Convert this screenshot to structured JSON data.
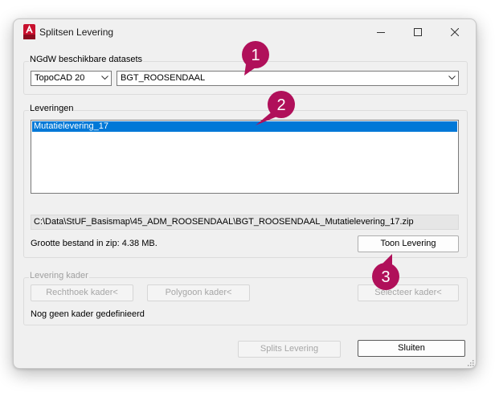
{
  "window": {
    "title": "Splitsen Levering",
    "icon": "autocad-a-icon",
    "controls": [
      "minimize-icon",
      "maximize-icon",
      "close-icon"
    ]
  },
  "datasets": {
    "group_label": "NGdW beschikbare datasets",
    "software_select": "TopoCAD 20",
    "dataset_select": "BGT_ROOSENDAAL"
  },
  "leveringen": {
    "group_label": "Leveringen",
    "items": [
      "Mutatielevering_17"
    ],
    "selected_index": 0,
    "path": "C:\\Data\\StUF_Basismap\\45_ADM_ROOSENDAAL\\BGT_ROOSENDAAL_Mutatielevering_17.zip",
    "size_text": "Grootte bestand in zip: 4.38 MB.",
    "show_button": "Toon Levering"
  },
  "kader": {
    "group_label": "Levering kader",
    "rectangle_button": "Rechthoek kader<",
    "polygon_button": "Polygoon kader<",
    "select_button": "Selecteer kader<",
    "status": "Nog geen kader gedefinieerd"
  },
  "footer": {
    "split_button": "Splits Levering",
    "close_button": "Sluiten"
  },
  "callouts": [
    "1",
    "2",
    "3"
  ],
  "colors": {
    "callout": "#b0105a",
    "selection": "#0078d7",
    "autocad_red": "#c8102e"
  }
}
